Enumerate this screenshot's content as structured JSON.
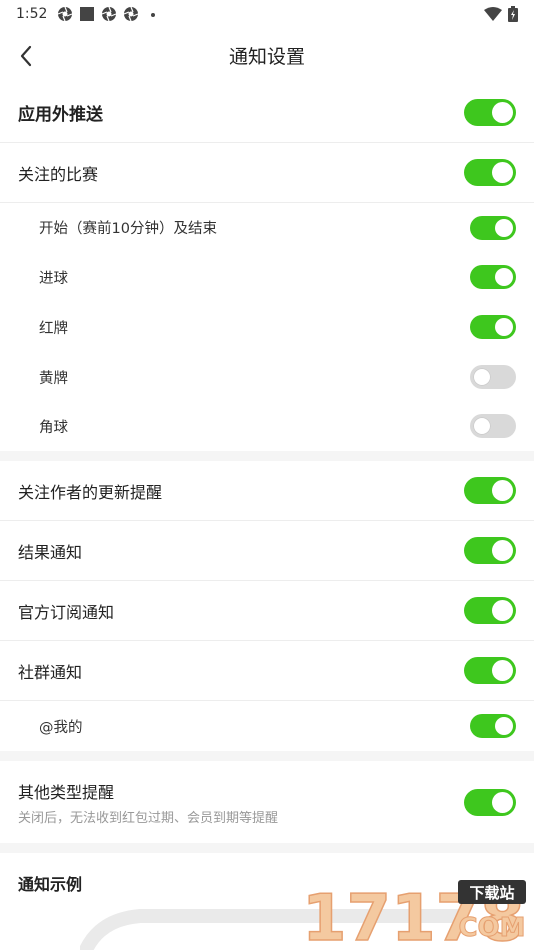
{
  "status": {
    "time": "1:52"
  },
  "nav": {
    "title": "通知设置"
  },
  "settings": {
    "push": {
      "label": "应用外推送",
      "on": true
    },
    "followed_matches": {
      "label": "关注的比赛",
      "on": true
    },
    "start_end": {
      "label": "开始（赛前10分钟）及结束",
      "on": true
    },
    "goal": {
      "label": "进球",
      "on": true
    },
    "red_card": {
      "label": "红牌",
      "on": true
    },
    "yellow_card": {
      "label": "黄牌",
      "on": false
    },
    "corner": {
      "label": "角球",
      "on": false
    },
    "author_updates": {
      "label": "关注作者的更新提醒",
      "on": true
    },
    "result": {
      "label": "结果通知",
      "on": true
    },
    "official_sub": {
      "label": "官方订阅通知",
      "on": true
    },
    "community": {
      "label": "社群通知",
      "on": true
    },
    "mention": {
      "label": "@我的",
      "on": true
    },
    "other": {
      "label": "其他类型提醒",
      "desc": "关闭后，无法收到红包过期、会员到期等提醒",
      "on": true
    }
  },
  "example": {
    "label": "通知示例"
  },
  "watermark": {
    "number": "17178",
    "tag": "下载站",
    "domain": "COM"
  },
  "colors": {
    "toggle_on": "#3ec71e",
    "toggle_off": "#d9d9d9"
  }
}
